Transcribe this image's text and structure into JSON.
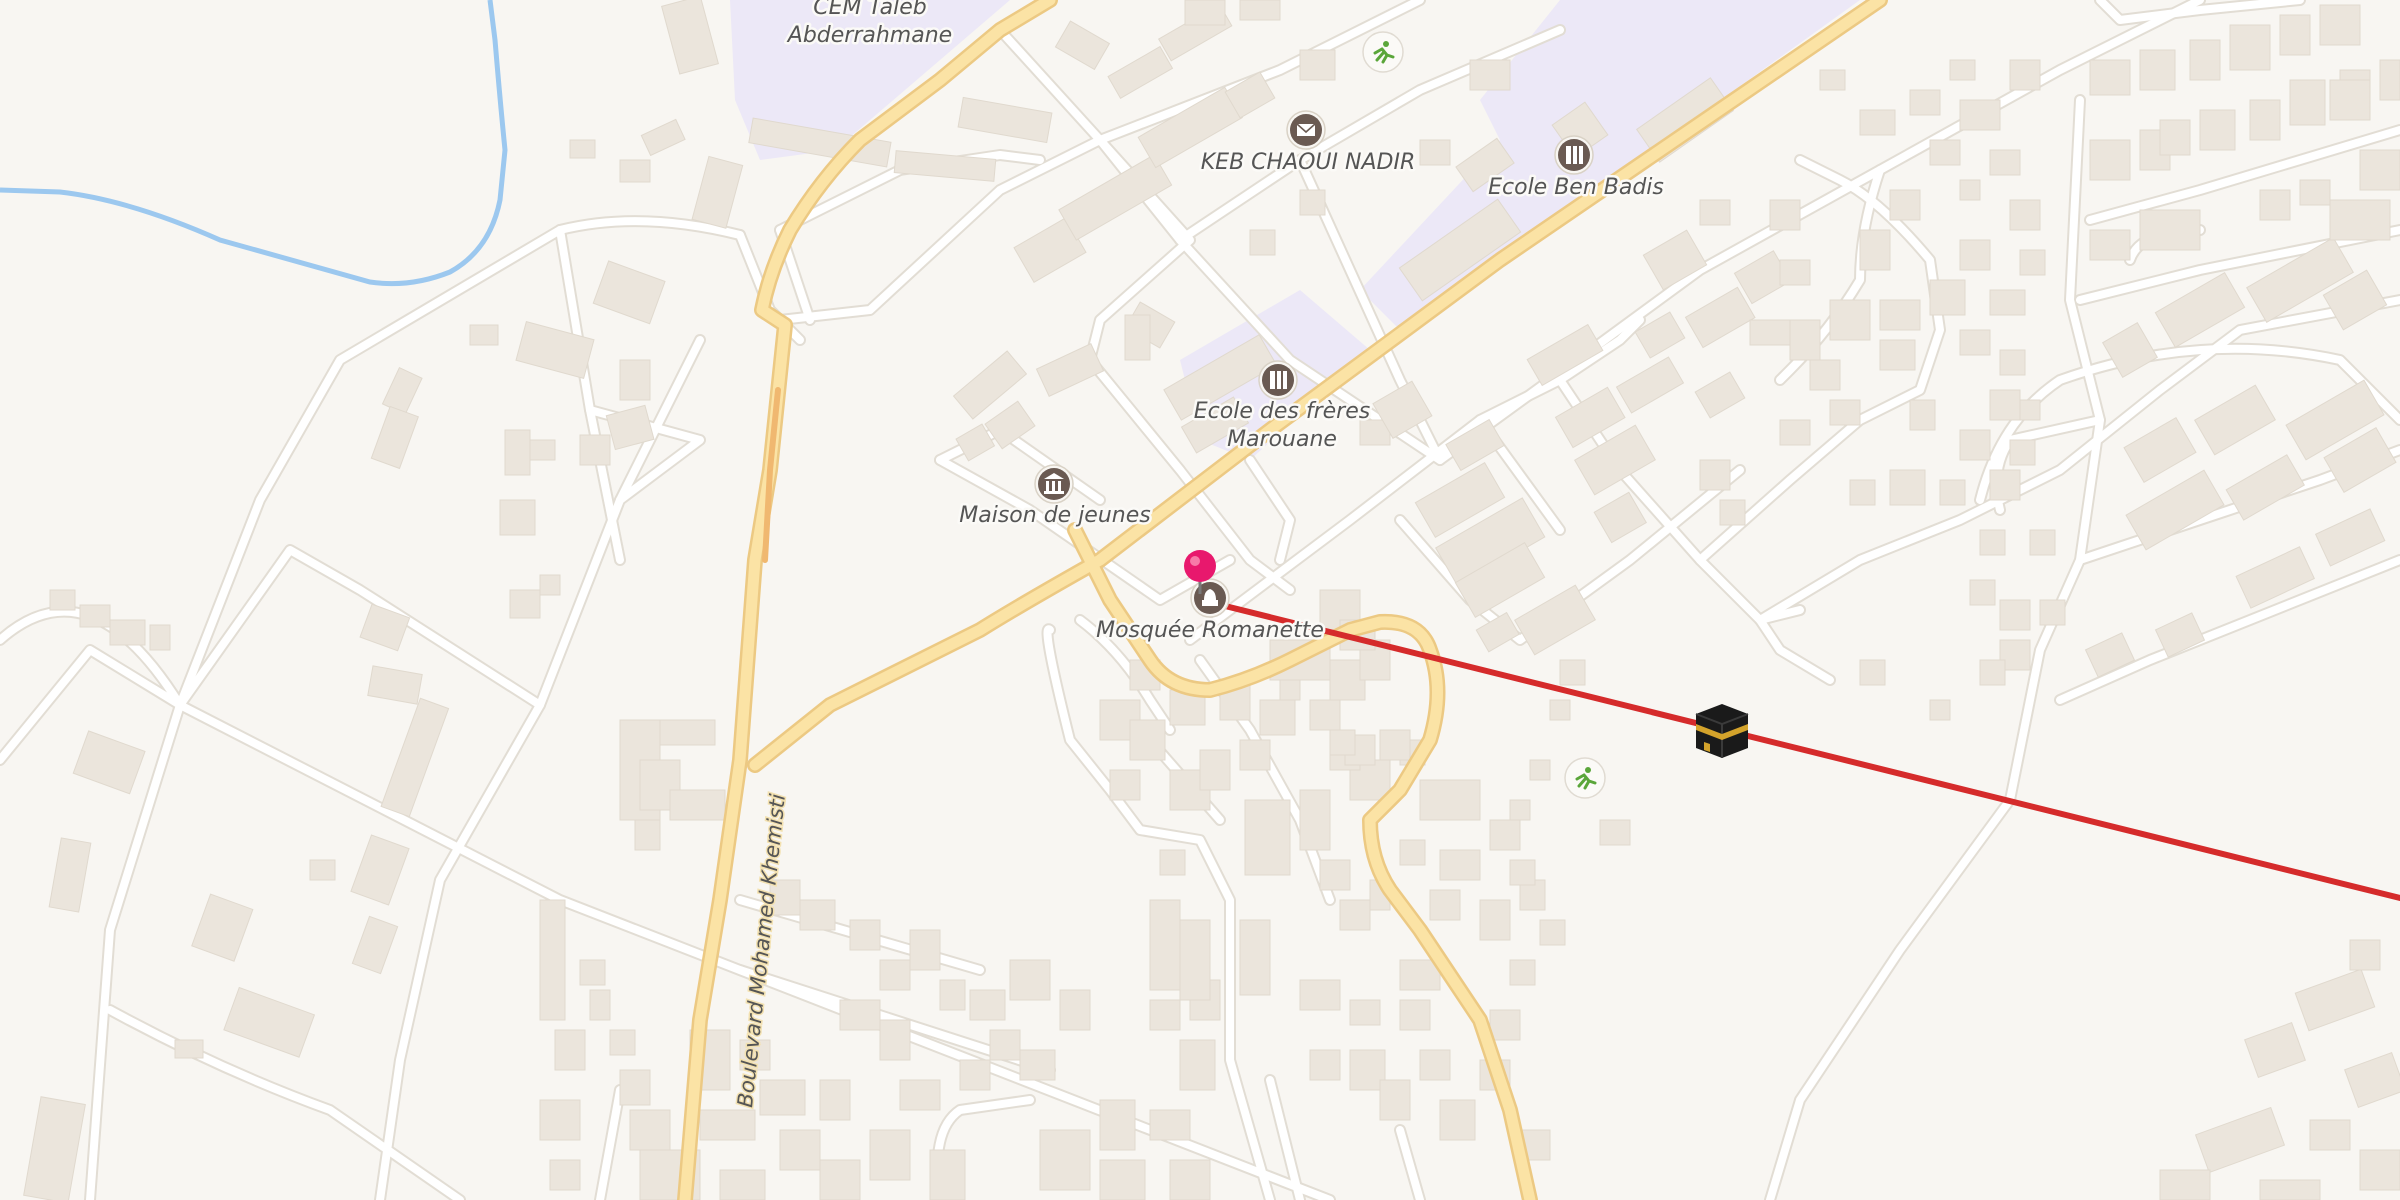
{
  "map": {
    "pois": [
      {
        "id": "cem",
        "label": "CEM Taleb Abderrahmane"
      },
      {
        "id": "keb",
        "label": "KEB CHAOUI NADIR",
        "icon": "post-office-icon"
      },
      {
        "id": "ben-badis",
        "label": "Ecole Ben Badis",
        "icon": "school-icon"
      },
      {
        "id": "freres",
        "label": "Ecole des frères Marouane",
        "icon": "school-icon"
      },
      {
        "id": "maison",
        "label": "Maison de jeunes",
        "icon": "museum-icon"
      },
      {
        "id": "mosquee",
        "label": "Mosquée Romanette",
        "icon": "mosque-icon"
      }
    ],
    "cem_line1": "CEM Taleb",
    "cem_line2": "Abderrahmane",
    "keb_label": "KEB CHAOUI NADIR",
    "ben_badis_label": "Ecole Ben Badis",
    "freres_line1": "Ecole des frères",
    "freres_line2": "Marouane",
    "maison_label": "Maison de jeunes",
    "mosquee_label": "Mosquée Romanette",
    "road_label": "Boulevard Mohamed Khemisti",
    "colors": {
      "background": "#f8f6f2",
      "building": "#ebe5dc",
      "road": "#ffffff",
      "main_road": "#fbe3a5",
      "main_road_casing": "#ecc983",
      "school_area": "#ece8f7",
      "river": "#9cc8ef",
      "qibla_line": "#d52b2b",
      "pin": "#e8186d",
      "sport_icon": "#5aa63a"
    },
    "markers": [
      {
        "id": "location-pin",
        "icon": "map-pin-icon"
      },
      {
        "id": "kaaba",
        "icon": "kaaba-icon"
      },
      {
        "id": "sport1",
        "icon": "sport-icon"
      },
      {
        "id": "sport2",
        "icon": "sport-icon"
      }
    ]
  }
}
